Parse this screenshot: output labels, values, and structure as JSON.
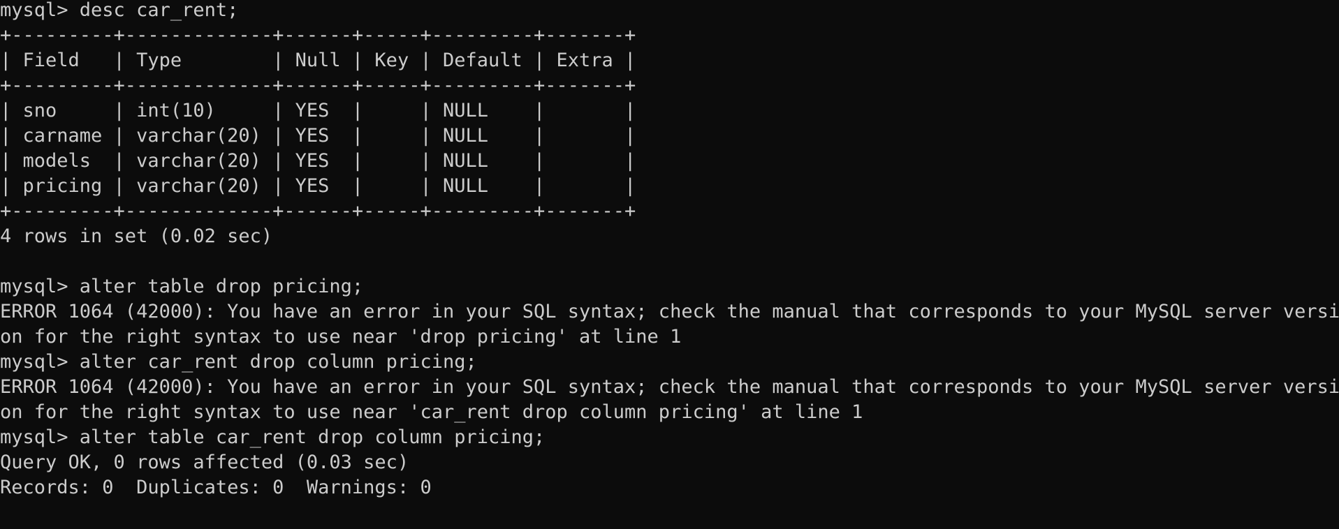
{
  "terminal": {
    "lines": [
      "mysql> desc car_rent;",
      "+---------+-------------+------+-----+---------+-------+",
      "| Field   | Type        | Null | Key | Default | Extra |",
      "+---------+-------------+------+-----+---------+-------+",
      "| sno     | int(10)     | YES  |     | NULL    |       |",
      "| carname | varchar(20) | YES  |     | NULL    |       |",
      "| models  | varchar(20) | YES  |     | NULL    |       |",
      "| pricing | varchar(20) | YES  |     | NULL    |       |",
      "+---------+-------------+------+-----+---------+-------+",
      "4 rows in set (0.02 sec)",
      "",
      "mysql> alter table drop pricing;",
      "ERROR 1064 (42000): You have an error in your SQL syntax; check the manual that corresponds to your MySQL server versi",
      "on for the right syntax to use near 'drop pricing' at line 1",
      "mysql> alter car_rent drop column pricing;",
      "ERROR 1064 (42000): You have an error in your SQL syntax; check the manual that corresponds to your MySQL server versi",
      "on for the right syntax to use near 'car_rent drop column pricing' at line 1",
      "mysql> alter table car_rent drop column pricing;",
      "Query OK, 0 rows affected (0.03 sec)",
      "Records: 0  Duplicates: 0  Warnings: 0"
    ]
  }
}
